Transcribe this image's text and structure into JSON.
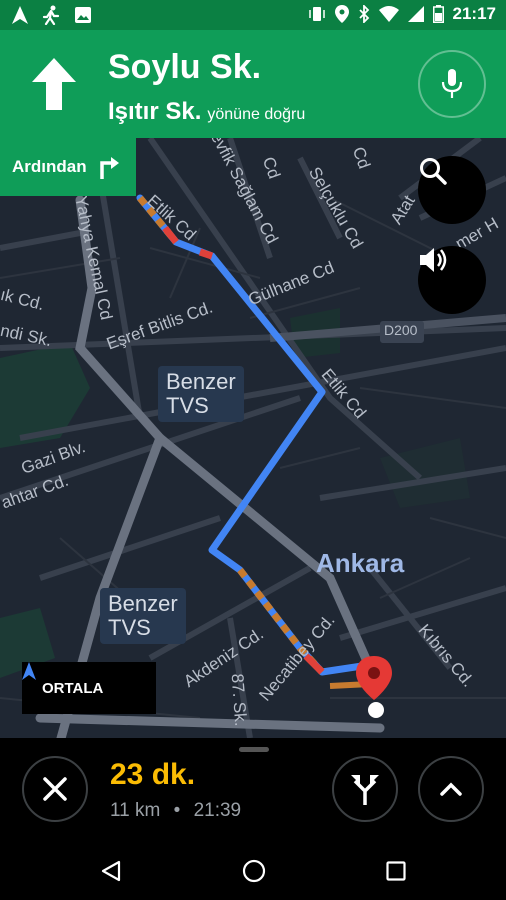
{
  "status_bar": {
    "time": "21:17",
    "background": "#0b8043",
    "left_icons": [
      "navigation-icon",
      "running-icon",
      "image-icon"
    ],
    "right_icons": [
      "vibrate-icon",
      "location-icon",
      "bluetooth-icon",
      "wifi-icon",
      "battery-icon"
    ]
  },
  "navigation": {
    "maneuver_icon": "straight-arrow-icon",
    "street": "Soylu Sk.",
    "toward_street": "Işıtır Sk.",
    "toward_suffix": "yönüne doğru",
    "header_color": "#0f9d58"
  },
  "then_chip": {
    "label": "Ardından",
    "icon": "turn-right-icon"
  },
  "map": {
    "route_color": "#4285f4",
    "labels": {
      "etlik_top": "Etlik Cd",
      "sagiam": "evfik Sağlam Cd",
      "selcuklu": "Selçuklu Cd",
      "ataturk": "Atat",
      "omer": "mer H",
      "gulhane": "Gülhane Cd",
      "d200": "D200",
      "yahya_kemal": "Yahya Kemal Cd",
      "ik": "ık Cd.",
      "ndi": "ndi Sk.",
      "esref": "Eşref Bitlis Cd.",
      "etlik_mid": "Etlik Cd",
      "gazi": "Gazi Blv.",
      "ahtar": "ahtar Cd.",
      "akdeniz": "Akdeniz Cd.",
      "necatibey": "Necatibey Cd.",
      "kibris": "Kıbrıs Cd.",
      "sk87": "87. Sk.",
      "cd_top": "Cd",
      "cd_top2": "Cd"
    },
    "poi_1": [
      "Benzer",
      "TVS"
    ],
    "poi_2": [
      "Benzer",
      "TVS"
    ],
    "city": "Ankara",
    "search_icon": "search-icon",
    "sound_icon": "volume-icon",
    "recenter_label": "ORTALA"
  },
  "bottom_sheet": {
    "eta_time": "23 dk.",
    "distance": "11 km",
    "separator": "•",
    "arrival": "21:39",
    "close_icon": "close-icon",
    "alternate_routes_icon": "fork-route-icon",
    "expand_icon": "chevron-up-icon",
    "eta_color": "#fbbc04"
  },
  "system_nav": {
    "back_icon": "back-triangle-icon",
    "home_icon": "home-circle-icon",
    "recents_icon": "recents-square-icon"
  }
}
